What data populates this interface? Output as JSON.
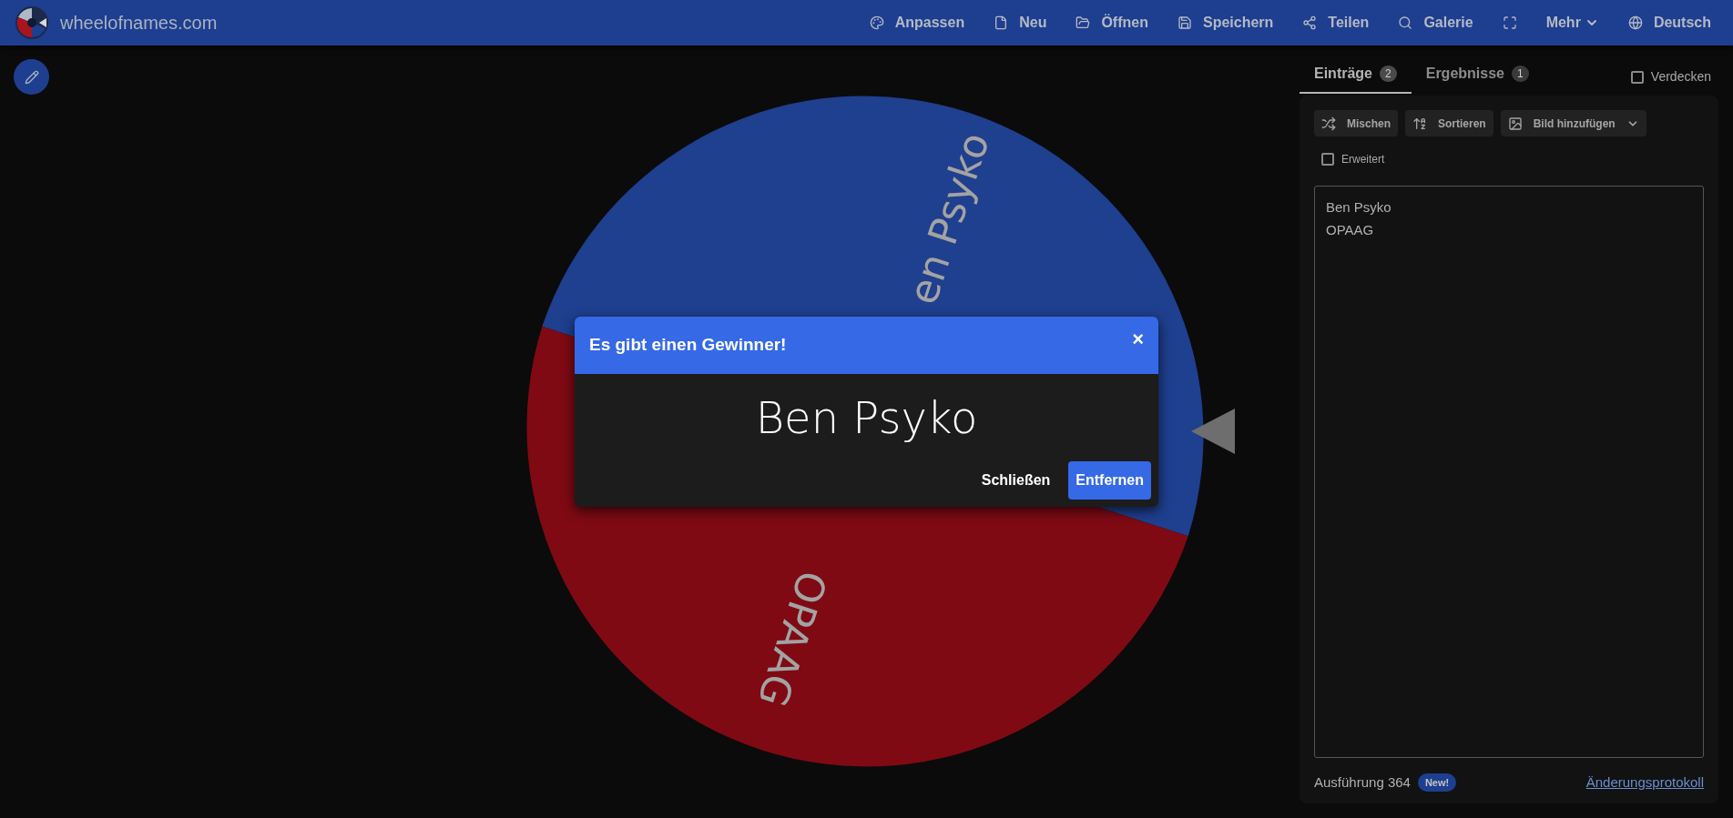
{
  "header": {
    "site_title": "wheelofnames.com",
    "menu": [
      {
        "kind": "link",
        "label": "Anpassen"
      },
      {
        "kind": "link",
        "label": "Neu"
      },
      {
        "kind": "link",
        "label": "Öffnen"
      },
      {
        "kind": "link",
        "label": "Speichern"
      },
      {
        "kind": "link",
        "label": "Teilen"
      },
      {
        "kind": "link",
        "label": "Galerie"
      },
      {
        "kind": "icon"
      },
      {
        "kind": "dropdown",
        "label": "Mehr"
      },
      {
        "kind": "link",
        "label": "Deutsch"
      }
    ]
  },
  "wheel": {
    "segments": [
      {
        "label": "en Psyko",
        "color": "#1f3f8f"
      },
      {
        "label": "OPAAG",
        "color": "#7f0a14"
      }
    ]
  },
  "winner_dialog": {
    "title": "Es gibt einen Gewinner!",
    "close": "×",
    "winner": "Ben Psyko",
    "buttons": [
      {
        "label": "Schließen",
        "primary": false
      },
      {
        "label": "Entfernen",
        "primary": true
      }
    ]
  },
  "sidebar": {
    "tabs": [
      {
        "label": "Einträge",
        "count": "2",
        "selected": true
      },
      {
        "label": "Ergebnisse",
        "count": "1",
        "selected": false
      }
    ],
    "hide_option": {
      "label": "Verdecken",
      "checked": false
    },
    "toolbar": [
      {
        "kind": "button",
        "label": "Mischen"
      },
      {
        "kind": "button",
        "label": "Sortieren"
      },
      {
        "kind": "dropdown",
        "label": "Bild hinzufügen"
      }
    ],
    "advanced_option": {
      "label": "Erweitert",
      "checked": false
    },
    "entries": [
      "Ben Psyko",
      "OPAAG"
    ],
    "version": "Ausführung 364",
    "version_badge": "New!",
    "changelog_link": "Änderungsprotokoll"
  }
}
